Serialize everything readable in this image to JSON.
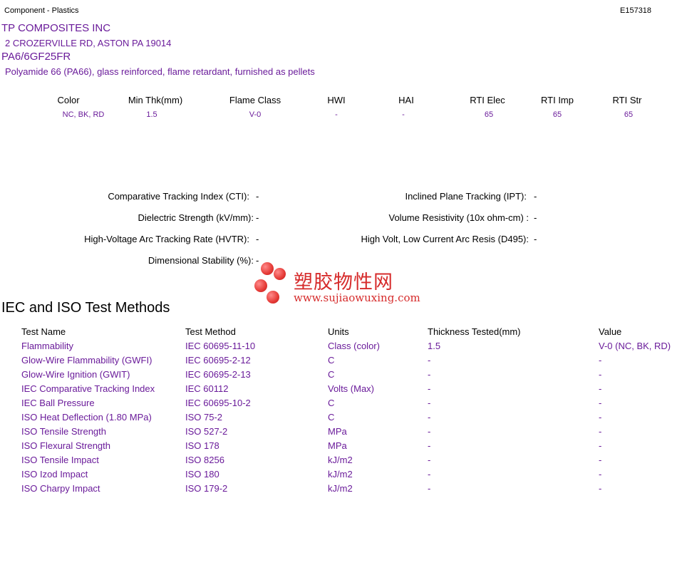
{
  "header": {
    "category": "Component - Plastics",
    "file_number": "E157318"
  },
  "company": {
    "name": "TP COMPOSITES INC",
    "address": "2 CROZERVILLE RD, ASTON PA   19014"
  },
  "product": {
    "grade": "PA6/6GF25FR",
    "description": "Polyamide 66 (PA66), glass reinforced, flame retardant, furnished as pellets"
  },
  "ratings": {
    "headers": [
      "Color",
      "Min Thk(mm)",
      "Flame Class",
      "HWI",
      "HAI",
      "RTI Elec",
      "RTI Imp",
      "RTI Str"
    ],
    "values": [
      "NC, BK, RD",
      "1.5",
      "V-0",
      "-",
      "-",
      "65",
      "65",
      "65"
    ]
  },
  "properties": {
    "cti": {
      "label": "Comparative Tracking Index (CTI):",
      "value": "-"
    },
    "ipt": {
      "label": "Inclined Plane Tracking (IPT):",
      "value": "-"
    },
    "dielectric": {
      "label": "Dielectric Strength (kV/mm):",
      "value": "-"
    },
    "volume_res": {
      "label": "Volume Resistivity (10x ohm-cm) :",
      "value": "-"
    },
    "hvtr": {
      "label": "High-Voltage Arc Tracking Rate (HVTR):",
      "value": "-"
    },
    "d495": {
      "label": "High Volt, Low Current Arc Resis (D495):",
      "value": "-"
    },
    "dim_stab": {
      "label": "Dimensional Stability (%):",
      "value": "-"
    }
  },
  "watermark": {
    "text": "塑胶物性网",
    "url": "www.sujiaowuxing.com"
  },
  "test_methods": {
    "title": "IEC and ISO Test Methods",
    "columns": [
      "Test Name",
      "Test Method",
      "Units",
      "Thickness Tested(mm)",
      "Value"
    ],
    "rows": [
      [
        "Flammability",
        "IEC 60695-11-10",
        "Class (color)",
        "1.5",
        "V-0 (NC, BK, RD)"
      ],
      [
        "Glow-Wire Flammability (GWFI)",
        "IEC 60695-2-12",
        "C",
        "-",
        "-"
      ],
      [
        "Glow-Wire Ignition (GWIT)",
        "IEC 60695-2-13",
        "C",
        "-",
        "-"
      ],
      [
        "IEC Comparative Tracking Index",
        "IEC 60112",
        "Volts (Max)",
        "-",
        "-"
      ],
      [
        "IEC Ball Pressure",
        "IEC 60695-10-2",
        "C",
        "-",
        "-"
      ],
      [
        "ISO Heat Deflection (1.80 MPa)",
        "ISO 75-2",
        "C",
        "-",
        "-"
      ],
      [
        "ISO Tensile Strength",
        "ISO 527-2",
        "MPa",
        "-",
        "-"
      ],
      [
        "ISO Flexural Strength",
        "ISO 178",
        "MPa",
        "-",
        "-"
      ],
      [
        "ISO Tensile Impact",
        "ISO 8256",
        "kJ/m2",
        "-",
        "-"
      ],
      [
        "ISO Izod Impact",
        "ISO 180",
        "kJ/m2",
        "-",
        "-"
      ],
      [
        "ISO Charpy Impact",
        "ISO 179-2",
        "kJ/m2",
        "-",
        "-"
      ]
    ]
  }
}
